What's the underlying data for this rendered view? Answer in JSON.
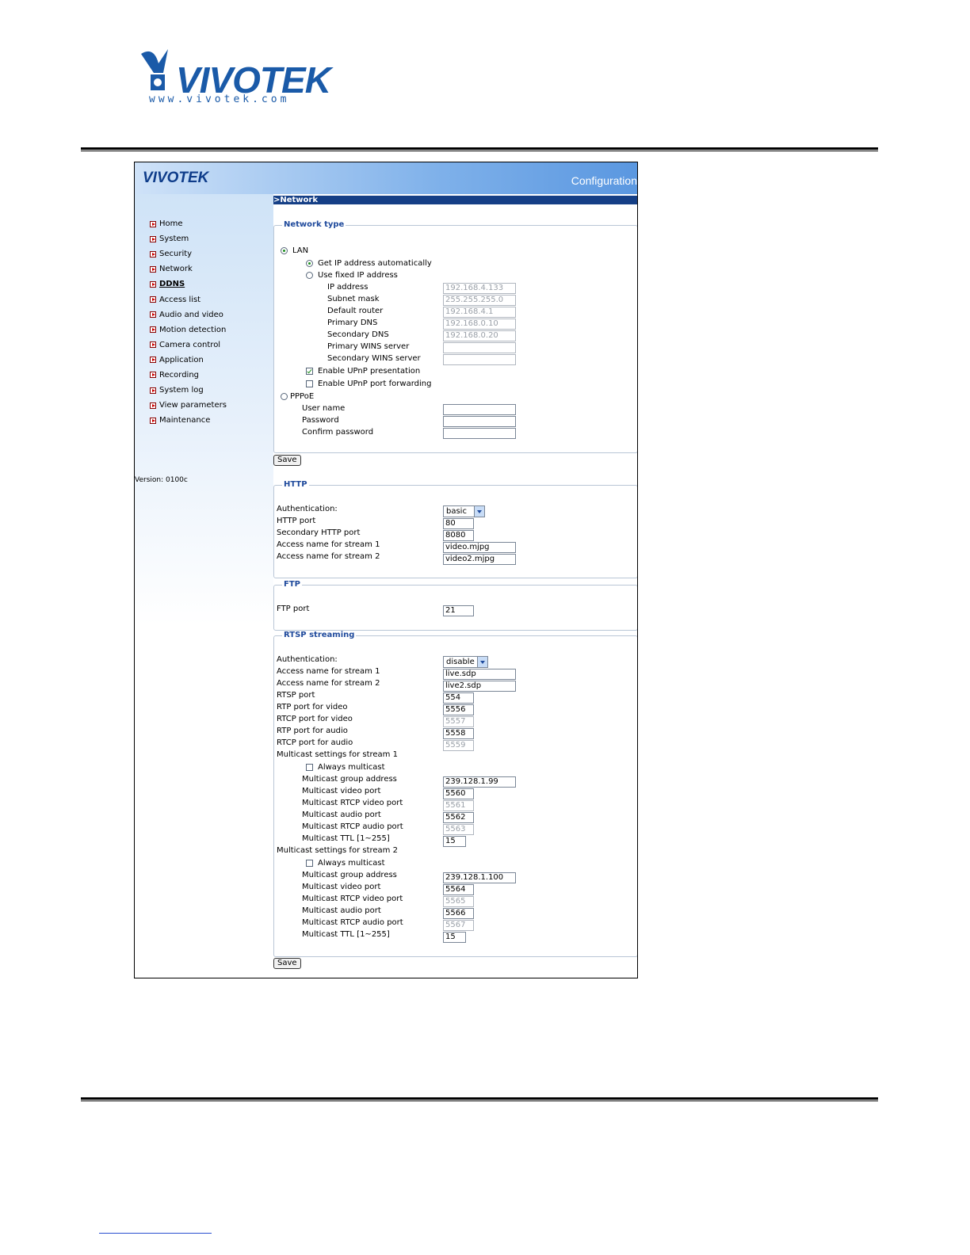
{
  "doc": {
    "logo_word": "VIVOTEK",
    "logo_url": "www.vivotek.com"
  },
  "banner": {
    "logo": "VIVOTEK",
    "section": "Configuration"
  },
  "sidebar": {
    "items": [
      {
        "label": "Home"
      },
      {
        "label": "System"
      },
      {
        "label": "Security"
      },
      {
        "label": "Network"
      },
      {
        "label": "DDNS"
      },
      {
        "label": "Access list"
      },
      {
        "label": "Audio and video"
      },
      {
        "label": "Motion detection"
      },
      {
        "label": "Camera control"
      },
      {
        "label": "Application"
      },
      {
        "label": "Recording"
      },
      {
        "label": "System log"
      },
      {
        "label": "View parameters"
      },
      {
        "label": "Maintenance"
      }
    ],
    "active_item": "DDNS",
    "version": "Version: 0100c"
  },
  "main": {
    "title": ">Network",
    "network_type": {
      "legend": "Network type",
      "lan_label": "LAN",
      "auto_label": "Get IP address automatically",
      "fixed_label": "Use fixed IP address",
      "fields": [
        {
          "label": "IP address",
          "value": "192.168.4.133"
        },
        {
          "label": "Subnet mask",
          "value": "255.255.255.0"
        },
        {
          "label": "Default router",
          "value": "192.168.4.1"
        },
        {
          "label": "Primary DNS",
          "value": "192.168.0.10"
        },
        {
          "label": "Secondary DNS",
          "value": "192.168.0.20"
        },
        {
          "label": "Primary WINS server",
          "value": ""
        },
        {
          "label": "Secondary WINS server",
          "value": ""
        }
      ],
      "upnp_presentation": "Enable UPnP presentation",
      "upnp_forwarding": "Enable UPnP port forwarding",
      "pppoe_label": "PPPoE",
      "pppoe_fields": [
        {
          "label": "User name",
          "value": ""
        },
        {
          "label": "Password",
          "value": ""
        },
        {
          "label": "Confirm password",
          "value": ""
        }
      ],
      "save": "Save"
    },
    "http": {
      "legend": "HTTP",
      "auth_label": "Authentication:",
      "auth_value": "basic",
      "port_label": "HTTP port",
      "port_value": "80",
      "sec_port_label": "Secondary HTTP port",
      "sec_port_value": "8080",
      "stream1_label": "Access name for stream 1",
      "stream1_value": "video.mjpg",
      "stream2_label": "Access name for stream 2",
      "stream2_value": "video2.mjpg"
    },
    "ftp": {
      "legend": "FTP",
      "port_label": "FTP port",
      "port_value": "21"
    },
    "rtsp": {
      "legend": "RTSP streaming",
      "auth_label": "Authentication:",
      "auth_value": "disable",
      "stream1_label": "Access name for stream 1",
      "stream1_value": "live.sdp",
      "stream2_label": "Access name for stream 2",
      "stream2_value": "live2.sdp",
      "rtsp_port_label": "RTSP port",
      "rtsp_port_value": "554",
      "rtp_video_label": "RTP port for video",
      "rtp_video_value": "5556",
      "rtcp_video_label": "RTCP port for video",
      "rtcp_video_value": "5557",
      "rtp_audio_label": "RTP port for audio",
      "rtp_audio_value": "5558",
      "rtcp_audio_label": "RTCP port for audio",
      "rtcp_audio_value": "5559",
      "mc1": {
        "title": "Multicast settings for stream 1",
        "always": "Always multicast",
        "group_label": "Multicast group address",
        "group_value": "239.128.1.99",
        "video_label": "Multicast video port",
        "video_value": "5560",
        "rtcp_video_label": "Multicast RTCP video port",
        "rtcp_video_value": "5561",
        "audio_label": "Multicast audio port",
        "audio_value": "5562",
        "rtcp_audio_label": "Multicast RTCP audio port",
        "rtcp_audio_value": "5563",
        "ttl_label": "Multicast TTL [1~255]",
        "ttl_value": "15"
      },
      "mc2": {
        "title": "Multicast settings for stream 2",
        "always": "Always multicast",
        "group_label": "Multicast group address",
        "group_value": "239.128.1.100",
        "video_label": "Multicast video port",
        "video_value": "5564",
        "rtcp_video_label": "Multicast RTCP video port",
        "rtcp_video_value": "5565",
        "audio_label": "Multicast audio port",
        "audio_value": "5566",
        "rtcp_audio_label": "Multicast RTCP audio port",
        "rtcp_audio_value": "5567",
        "ttl_label": "Multicast TTL [1~255]",
        "ttl_value": "15"
      },
      "save": "Save"
    }
  }
}
